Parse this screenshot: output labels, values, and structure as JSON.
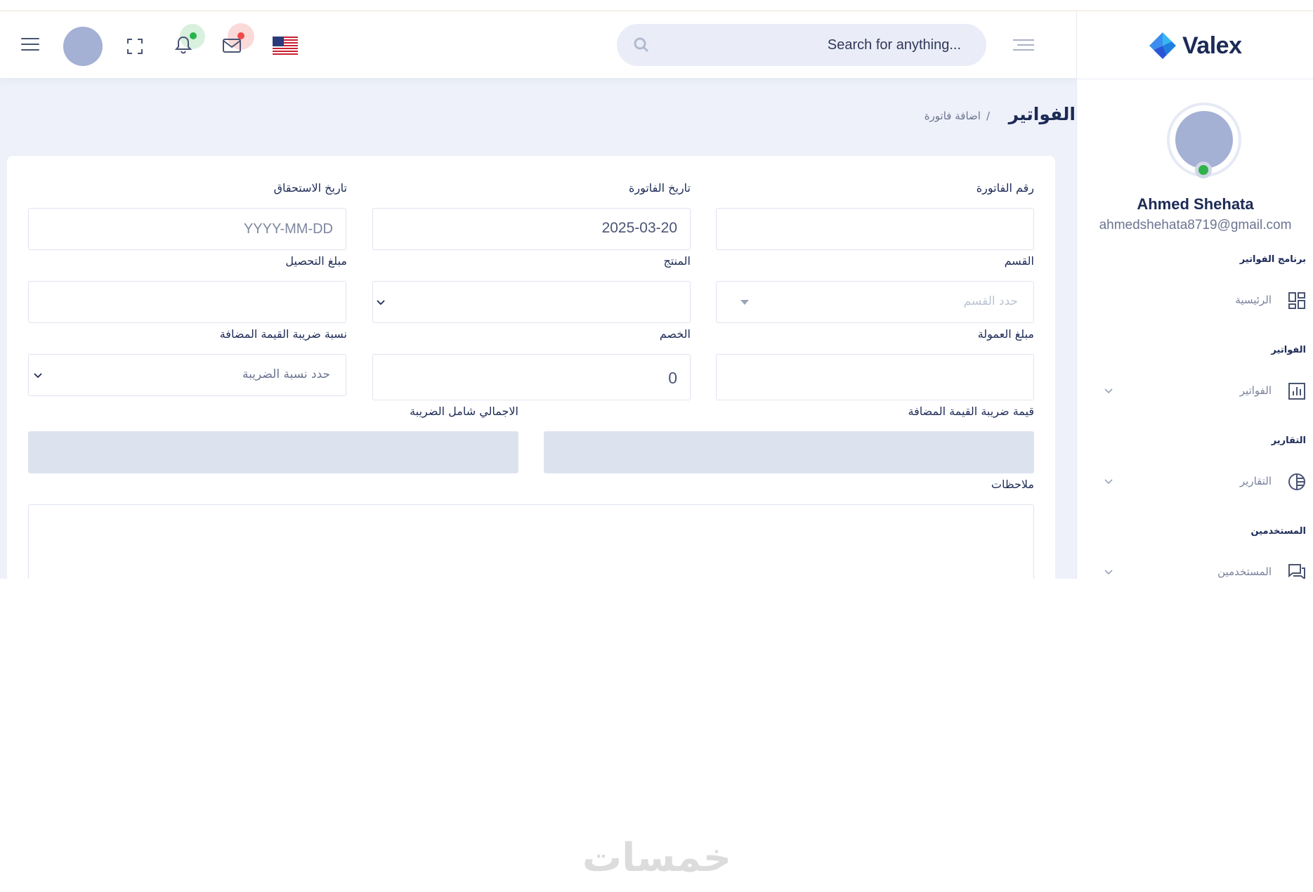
{
  "header": {
    "search_placeholder": "Search for anything...",
    "flag": "us-flag-icon"
  },
  "sidebar": {
    "logo_text": "Valex",
    "user_name": "Ahmed Shehata",
    "user_email": "ahmedshehata8719@gmail.com",
    "sections": [
      {
        "title": "برنامج الفواتير",
        "item": "الرئيسية",
        "icon": "dashboard-icon"
      },
      {
        "title": "الفواتير",
        "item": "الفواتير",
        "icon": "bar-chart-icon"
      },
      {
        "title": "التقارير",
        "item": "التقارير",
        "icon": "pie-chart-icon"
      },
      {
        "title": "المستخدمين",
        "item": "المستخدمين",
        "icon": "chat-icon"
      }
    ]
  },
  "page": {
    "title": "الفواتير",
    "breadcrumb": "اضافة فاتورة",
    "breadcrumb_sep": "/"
  },
  "form": {
    "invoice_number_label": "رقم الفاتورة",
    "invoice_number_value": "",
    "invoice_date_label": "تاريخ الفاتورة",
    "invoice_date_value": "2025-03-20",
    "due_date_label": "تاريخ الاستحقاق",
    "due_date_placeholder": "YYYY-MM-DD",
    "section_label": "القسم",
    "section_placeholder": "حدد القسم",
    "product_label": "المنتج",
    "collection_amount_label": "مبلغ التحصيل",
    "commission_amount_label": "مبلغ العمولة",
    "discount_label": "الخصم",
    "discount_value": "0",
    "vat_rate_label": "نسبة ضريبة القيمة المضافة",
    "vat_rate_placeholder": "حدد نسبة الضريبة",
    "vat_value_label": "قيمة ضريبة القيمة المضافة",
    "total_label": "الاجمالي شامل الضريبة",
    "notes_label": "ملاحظات"
  },
  "colors": {
    "brand": "#1c2a56",
    "online": "#2fb24a",
    "notification": "#28b44c",
    "mail_alert": "#ee4a4a"
  },
  "watermark": "خمسات"
}
